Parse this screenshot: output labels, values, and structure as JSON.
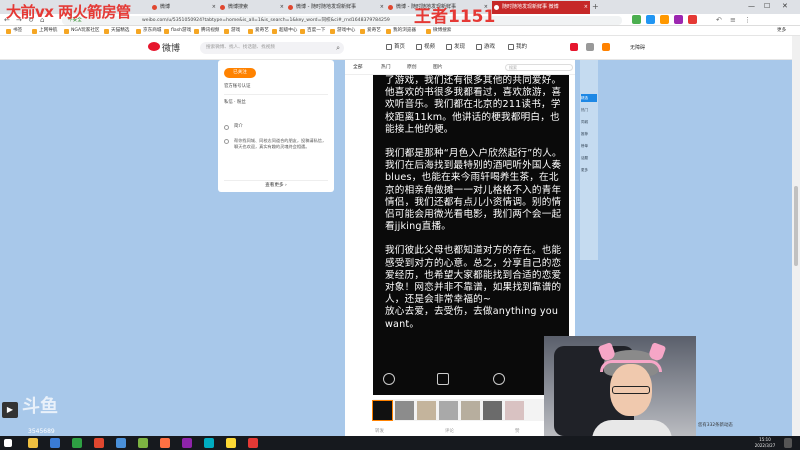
{
  "browser": {
    "tabs": [
      {
        "label": "微博",
        "active": false
      },
      {
        "label": "微博搜索",
        "active": false
      },
      {
        "label": "微博 - 随时随地发现新鲜事",
        "active": false
      },
      {
        "label": "微博 - 随时随地发现新鲜事",
        "active": false
      },
      {
        "label": "随时随地发现新鲜事 微博",
        "active": true
      }
    ],
    "url": "weibo.com/u/5351050924?tabtype=home&is_all=1&is_search=1&key_word=同校&ci#_rnd1648379784259",
    "security_label": "不安全",
    "bookmarks": [
      "书签",
      "上网导航",
      "NGA玩家社区",
      "天猫精选",
      "京东商城",
      "flash游戏",
      "腾讯视频",
      "游戏",
      "爱奇艺",
      "超级中心",
      "百度一下",
      "游戏中心",
      "爱奇艺",
      "我的浏览器",
      "微博搜索",
      "更多"
    ]
  },
  "overlay": {
    "left_text": "大前vx 两火箭房管",
    "right_text": "王者1151"
  },
  "weibo": {
    "logo": "微博",
    "search_placeholder": "搜索微博、找人、找话题、找视频",
    "nav": [
      "首页",
      "视频",
      "发现",
      "游戏",
      "我的"
    ],
    "right_label": "无障碍"
  },
  "profile_card": {
    "follow_label": "已关注",
    "lines": [
      "官方账号认证",
      "私信 · 粉丝",
      "简介"
    ],
    "description": "帮你找同城、同校志同道合的朋友，投稿请私信，聊天也欢迎，真实有趣的灵魂终会相遇。",
    "more_label": "查看更多 ›"
  },
  "feed": {
    "tabs": [
      "全部",
      "热门",
      "原创",
      "图片"
    ],
    "search_placeholder": "搜索",
    "paragraphs": [
      "了游戏，我们还有很多其他的共同爱好。他喜欢的书很多我都看过，喜欢旅游，喜欢听音乐。我们都在北京的211读书，学校距离11km。他讲话的梗我都明白，也能接上他的梗。",
      "我们都是那种“月色入户欣然起行”的人。我们在后海找到最特别的酒吧听外国人奏blues，也能在来今雨轩喝养生茶，在北京的相亲角做摊一一对儿格格不入的青年情侣，我们还都有点儿小资情调。别的情侣可能会用微光看电影，我们两个会一起看jjking直播。",
      "我们彼此父母也都知道对方的存在。也能感受到对方的心意。总之，分享自己的恋爱经历，也希望大家都能找到合适的恋爱对象！网恋并非不靠谱，如果找到靠谱的人，还是会非常幸福的~\n放心去爱，去受伤，去做anything you want。"
    ],
    "footer": [
      "转发",
      "评论",
      "赞"
    ]
  },
  "right_panel": {
    "side_items": [
      "精选",
      "热门",
      "同城",
      "推荐",
      "榜单",
      "话题",
      "更多"
    ],
    "notice": "您有332条新动态"
  },
  "stream": {
    "logo_text": "斗鱼",
    "room_id": "3545689"
  },
  "taskbar": {
    "time": "15:10",
    "date": "2022/3/27"
  },
  "colors": {
    "page_bg": "#a8c8ea",
    "weibo_red": "#e6162d",
    "follow_orange": "#ff8200",
    "overlay_red": "#e53935"
  }
}
